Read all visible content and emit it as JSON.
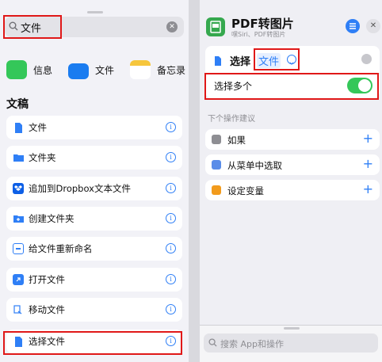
{
  "search": {
    "value": "文件",
    "clear": "✕"
  },
  "apps": [
    {
      "label": "信息",
      "color": "#34c759"
    },
    {
      "label": "文件",
      "color": "#1a7cf0"
    },
    {
      "label": "备忘录",
      "color": "#f6c63c"
    }
  ],
  "section_title": "文稿",
  "actions": [
    {
      "label": "文件",
      "icon": "document-icon",
      "color": "#2f7ff6"
    },
    {
      "label": "文件夹",
      "icon": "folder-icon",
      "color": "#2f7ff6"
    },
    {
      "label": "追加到Dropbox文本文件",
      "icon": "dropbox-icon",
      "color": "#0d5fe6"
    },
    {
      "label": "创建文件夹",
      "icon": "new-folder-icon",
      "color": "#2f7ff6"
    },
    {
      "label": "给文件重新命名",
      "icon": "rename-icon",
      "color": "#2f7ff6"
    },
    {
      "label": "打开文件",
      "icon": "open-file-icon",
      "color": "#2f7ff6"
    },
    {
      "label": "移动文件",
      "icon": "move-file-icon",
      "color": "#2f7ff6"
    },
    {
      "label": "选择文件",
      "icon": "select-file-icon",
      "color": "#2f7ff6"
    }
  ],
  "info_glyph": "i",
  "shortcut": {
    "title": "PDF转图片",
    "subtitle": "嘿Siri、PDF转图片",
    "close": "✕"
  },
  "action_card": {
    "verb": "选择",
    "param": "文件"
  },
  "select_multiple": {
    "label": "选择多个",
    "enabled": true
  },
  "suggestions_title": "下个操作建议",
  "suggestions": [
    {
      "label": "如果",
      "icon": "if-icon",
      "color": "#8e8e93"
    },
    {
      "label": "从菜单中选取",
      "icon": "menu-icon",
      "color": "#5a8de8"
    },
    {
      "label": "设定变量",
      "icon": "variable-icon",
      "color": "#f29b1c"
    }
  ],
  "plus_glyph": "+",
  "bottom_search": {
    "placeholder": "搜索 App和操作"
  }
}
